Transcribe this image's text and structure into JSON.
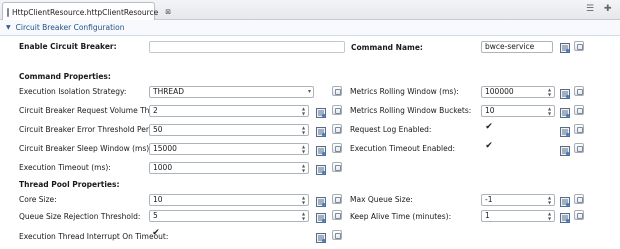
{
  "tab": {
    "title": "HttpClientResource.httpClientResource",
    "close": "⊠"
  },
  "toolbar": {
    "menu": "☰",
    "pin": "✚"
  },
  "section": {
    "title": "Circuit Breaker Configuration"
  },
  "top": {
    "enable_label": "Enable Circuit Breaker:",
    "enable_checked": "✔",
    "command_label": "Command Name:",
    "command_value": "bwce-service"
  },
  "command_props": {
    "header": "Command Properties:",
    "isolation_label": "Execution Isolation Strategy:",
    "isolation_value": "THREAD",
    "volume_label": "Circuit Breaker Request Volume Threshold:",
    "volume_value": "2",
    "error_label": "Circuit Breaker Error Threshold Percentage:",
    "error_value": "50",
    "sleep_label": "Circuit Breaker Sleep Window (ms):",
    "sleep_value": "15000",
    "timeout_label": "Execution Timeout (ms):",
    "timeout_value": "1000",
    "rolling_label": "Metrics Rolling Window (ms):",
    "rolling_value": "100000",
    "buckets_label": "Metrics Rolling Window Buckets:",
    "buckets_value": "10",
    "reqlog_label": "Request Log Enabled:",
    "reqlog_checked": "✔",
    "timeout_enabled_label": "Execution Timeout Enabled:",
    "timeout_enabled_checked": "✔"
  },
  "thread_props": {
    "header": "Thread Pool Properties:",
    "core_label": "Core Size:",
    "core_value": "10",
    "queue_reject_label": "Queue Size Rejection Threshold:",
    "queue_reject_value": "5",
    "interrupt_label": "Execution Thread Interrupt On Timeout:",
    "interrupt_checked": "✔",
    "max_queue_label": "Max Queue Size:",
    "max_queue_value": "-1",
    "keepalive_label": "Keep Alive Time (minutes):",
    "keepalive_value": "1"
  },
  "spin": {
    "up": "▲",
    "down": "▼"
  },
  "dropdown": {
    "arrow": "▾"
  }
}
